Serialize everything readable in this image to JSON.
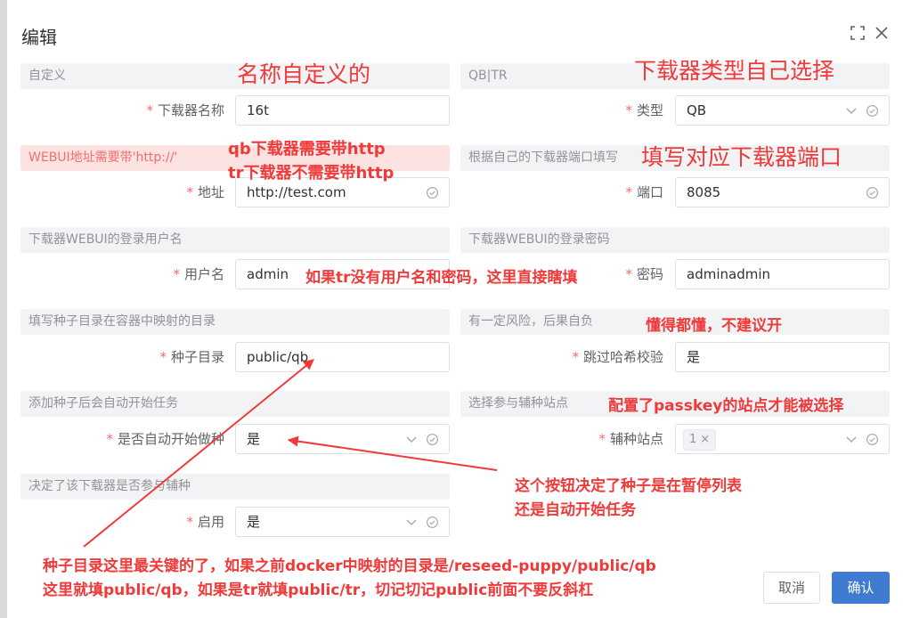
{
  "dialog": {
    "title": "编辑",
    "icons": {
      "maximize": "maximize-icon",
      "close": "close-icon"
    }
  },
  "fields": {
    "name": {
      "hint": "自定义",
      "label": "下载器名称",
      "value": "16t"
    },
    "type": {
      "hint": "QB|TR",
      "label": "类型",
      "value": "QB"
    },
    "address": {
      "hint": "WEBUI地址需要带'http://'",
      "label": "地址",
      "value": "http://test.com"
    },
    "port": {
      "hint": "根据自己的下载器端口填写",
      "label": "端口",
      "value": "8085"
    },
    "username": {
      "hint": "下载器WEBUI的登录用户名",
      "label": "用户名",
      "value": "admin"
    },
    "password": {
      "hint": "下载器WEBUI的登录密码",
      "label": "密码",
      "value": "adminadmin"
    },
    "torrent_dir": {
      "hint": "填写种子目录在容器中映射的目录",
      "label": "种子目录",
      "value": "public/qb"
    },
    "skip_hash": {
      "hint": "有一定风险，后果自负",
      "label": "跳过哈希校验",
      "value": "是"
    },
    "auto_start": {
      "hint": "添加种子后会自动开始任务",
      "label": "是否自动开始做种",
      "value": "是"
    },
    "sites": {
      "hint": "选择参与辅种站点",
      "label": "辅种站点",
      "tag": "1",
      "tag_close": "×"
    },
    "enabled": {
      "hint": "决定了该下载器是否参与辅种",
      "label": "启用",
      "value": "是"
    }
  },
  "annotations": {
    "name_custom": "名称自定义的",
    "type_select": "下载器类型自己选择",
    "qb_http": "qb下载器需要带http",
    "tr_http": "tr下载器不需要带http",
    "port_fill": "填写对应下载器端口",
    "tr_nouser": "如果tr没有用户名和密码，这里直接瞎填",
    "skip_warn": "懂得都懂，不建议开",
    "passkey": "配置了passkey的站点才能被选择",
    "button_line1": "这个按钮决定了种子是在暂停列表",
    "button_line2": "还是自动开始任务",
    "dir_line1": "种子目录这里最关键的了，如果之前docker中映射的目录是/reseed-puppy/public/qb",
    "dir_line2": "这里就填public/qb，如果是tr就填public/tr，切记切记public前面不要反斜杠"
  },
  "footer": {
    "cancel": "取消",
    "confirm": "确认"
  },
  "colors": {
    "annotation": "#f03a3a",
    "primary": "#3e7bd1",
    "hint_bg": "#f2f3f5",
    "warn_bg": "#fde2e2"
  }
}
